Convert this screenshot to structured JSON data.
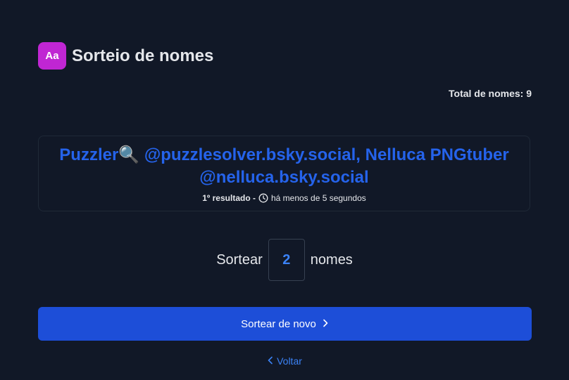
{
  "header": {
    "icon_text": "Aa",
    "title": "Sorteio de nomes"
  },
  "summary": {
    "total_label": "Total de nomes: 9"
  },
  "result": {
    "names": "Puzzler🔍 @puzzlesolver.bsky.social, Nelluca PNGtuber @nelluca.bsky.social",
    "ordinal": "1º resultado -",
    "time": "há menos de 5 segundos"
  },
  "draw": {
    "prefix": "Sortear",
    "count": "2",
    "suffix": "nomes"
  },
  "actions": {
    "redraw_label": "Sortear de novo",
    "back_label": "Voltar"
  },
  "colors": {
    "background": "#111827",
    "accent": "#1d4ed8",
    "link": "#3b82f6",
    "brand_icon": "#c026d3"
  }
}
